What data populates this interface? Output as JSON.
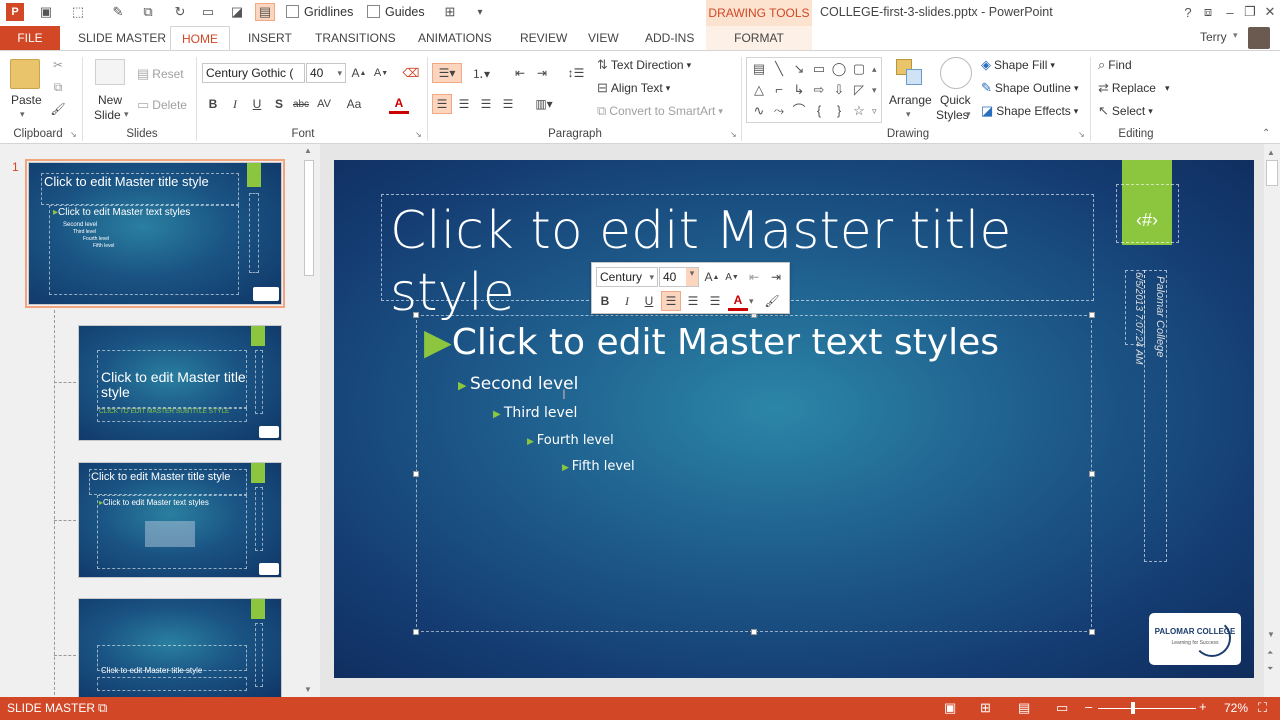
{
  "app": {
    "title": "COLLEGE-first-3-slides.pptx - PowerPoint",
    "context_tab_group": "DRAWING TOOLS",
    "user": "Terry"
  },
  "quick_access": {
    "gridlines_label": "Gridlines",
    "guides_label": "Guides"
  },
  "tabs": [
    {
      "label": "FILE"
    },
    {
      "label": "SLIDE MASTER"
    },
    {
      "label": "HOME"
    },
    {
      "label": "INSERT"
    },
    {
      "label": "TRANSITIONS"
    },
    {
      "label": "ANIMATIONS"
    },
    {
      "label": "REVIEW"
    },
    {
      "label": "VIEW"
    },
    {
      "label": "ADD-INS"
    },
    {
      "label": "FORMAT"
    }
  ],
  "ribbon": {
    "clipboard": {
      "label": "Clipboard",
      "paste": "Paste"
    },
    "slides": {
      "label": "Slides",
      "new_slide_1": "New",
      "new_slide_2": "Slide",
      "reset": "Reset",
      "delete": "Delete"
    },
    "font": {
      "label": "Font",
      "family": "Century Gothic (",
      "size": "40"
    },
    "paragraph": {
      "label": "Paragraph",
      "text_direction": "Text Direction",
      "align_text": "Align Text",
      "convert_smartart": "Convert to SmartArt"
    },
    "drawing": {
      "label": "Drawing",
      "arrange": "Arrange",
      "quick_styles_1": "Quick",
      "quick_styles_2": "Styles",
      "shape_fill": "Shape Fill",
      "shape_outline": "Shape Outline",
      "shape_effects": "Shape Effects"
    },
    "editing": {
      "label": "Editing",
      "find": "Find",
      "replace": "Replace",
      "select": "Select"
    }
  },
  "thumbnails": {
    "number": "1",
    "master": {
      "title": "Click to edit Master title style",
      "body": "Click to edit Master text styles",
      "l2": "Second level",
      "l3": "Third level",
      "l4": "Fourth level",
      "l5": "Fifth level"
    },
    "layout1": {
      "title": "Click to edit Master title style",
      "subtitle": "CLICK TO EDIT MASTER SUBTITLE STYLE"
    },
    "layout2": {
      "title": "Click to edit Master title style",
      "body": "Click to edit Master text styles"
    },
    "layout3": {
      "title": "Click to edit Master title style"
    }
  },
  "slide": {
    "title": "Click to edit Master title style",
    "level1": "Click to edit Master text styles",
    "level2": "Second level",
    "level3": "Third level",
    "level4": "Fourth level",
    "level5": "Fifth level",
    "slide_number": "‹#›",
    "date": "6/5/2013",
    "time": "7:07:24 AM",
    "footer": "Palomar College",
    "logo_name": "PALOMAR COLLEGE",
    "logo_tagline": "Learning for Success"
  },
  "mini_toolbar": {
    "font": "Century",
    "size": "40"
  },
  "status": {
    "view": "SLIDE MASTER",
    "zoom": "72%"
  },
  "colors": {
    "accent": "#d24726",
    "slide_green": "#8cc63f",
    "slide_blue": "#1e5c8c"
  }
}
